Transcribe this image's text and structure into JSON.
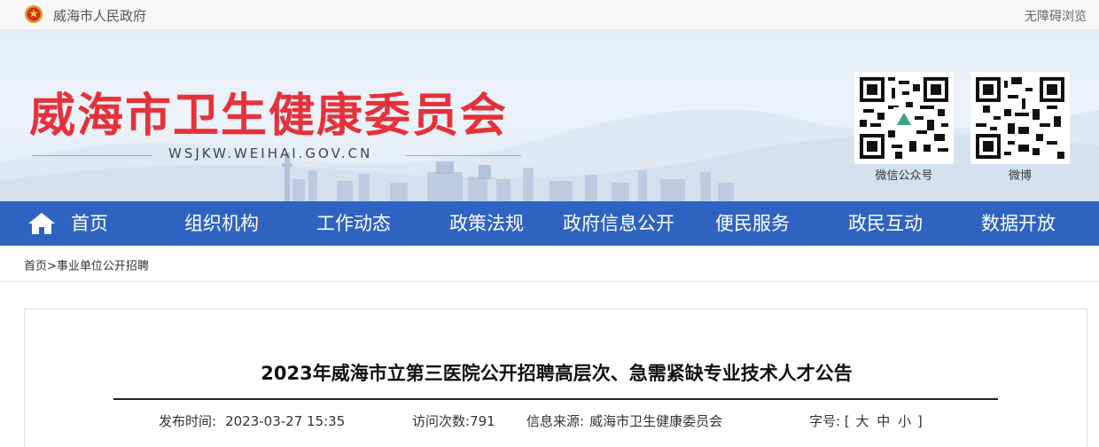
{
  "topbar": {
    "site_name": "威海市人民政府",
    "accessibility": "无障碍浏览"
  },
  "banner": {
    "title": "威海市卫生健康委员会",
    "domain": "WSJKW.WEIHAI.GOV.CN",
    "qr_wechat_label": "微信公众号",
    "qr_weibo_label": "微博"
  },
  "nav": {
    "items": [
      "首页",
      "组织机构",
      "工作动态",
      "政策法规",
      "政府信息公开",
      "便民服务",
      "政民互动",
      "数据开放"
    ]
  },
  "breadcrumb": {
    "home": "首页",
    "separator": ">",
    "current": "事业单位公开招聘"
  },
  "article": {
    "title": "2023年威海市立第三医院公开招聘高层次、急需紧缺专业技术人才公告",
    "publish_label": "发布时间:",
    "publish_time": "2023-03-27 15:35",
    "visits_label": "访问次数:",
    "visits": "791",
    "source_label": "信息来源:",
    "source": "威海市卫生健康委员会",
    "fontsize_label": "字号:",
    "fontsize_open": "[",
    "fontsize_large": "大",
    "fontsize_medium": "中",
    "fontsize_small": "小",
    "fontsize_close": "]"
  },
  "colors": {
    "title_red": "#e5323a",
    "nav_blue": "#2e63c2"
  },
  "icons": {
    "emblem": "national-emblem-icon",
    "home": "home-icon"
  }
}
